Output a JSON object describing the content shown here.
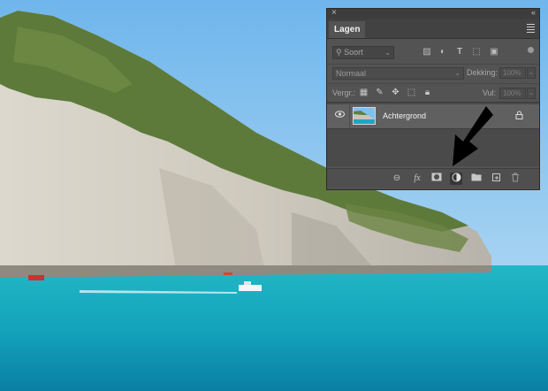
{
  "panel": {
    "close_icon": "×",
    "collapse_icon": "«",
    "tab_label": "Lagen",
    "filter": {
      "search_placeholder": "Soort",
      "icons": [
        "image-filter-icon",
        "adjustment-filter-icon",
        "type-filter-icon",
        "shape-filter-icon",
        "smartobject-filter-icon"
      ]
    },
    "blend": {
      "mode_value": "Normaal",
      "opacity_label": "Dekking:",
      "opacity_value": "100%"
    },
    "lock": {
      "label": "Vergr.:",
      "fill_label": "Vul:",
      "fill_value": "100%"
    },
    "layer": {
      "name": "Achtergrond"
    },
    "bottom_icons": [
      "link-icon",
      "fx-icon",
      "mask-icon",
      "adjustment-layer-icon",
      "folder-icon",
      "new-layer-icon",
      "trash-icon"
    ],
    "fx_label": "fx"
  },
  "colors": {
    "panel_bg": "#535353",
    "layer_selected": "#606060",
    "sky": "#7fc0ee",
    "sea": "#1aa9bd"
  }
}
